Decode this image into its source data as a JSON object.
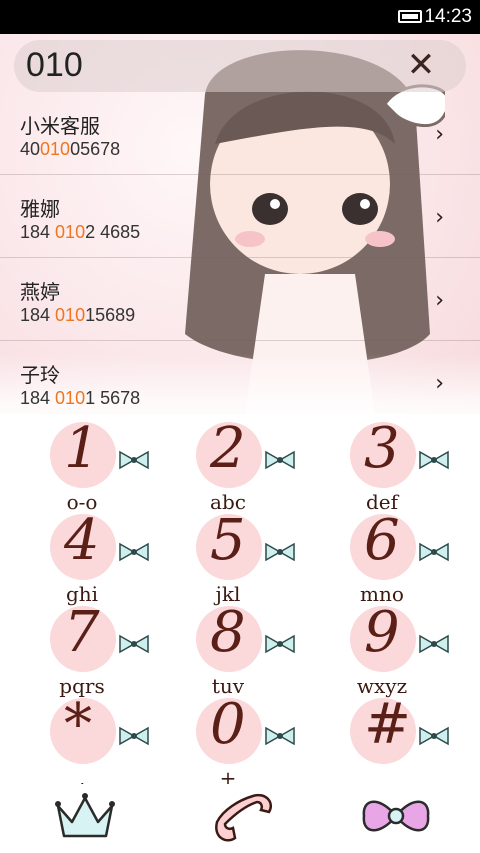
{
  "status_bar": {
    "time": "14:23"
  },
  "search": {
    "query": "010"
  },
  "contacts": [
    {
      "name": "小米客服",
      "num_pre": "40",
      "num_hl": "010",
      "num_post": "05678"
    },
    {
      "name": "雅娜",
      "num_pre": "184 ",
      "num_hl": "010",
      "num_post": "2 4685"
    },
    {
      "name": "燕婷",
      "num_pre": "184 ",
      "num_hl": "010",
      "num_post": "15689"
    },
    {
      "name": "子玲",
      "num_pre": "184 ",
      "num_hl": "010",
      "num_post": "1 5678"
    }
  ],
  "keypad": [
    {
      "digit": "1",
      "letters": "o-o"
    },
    {
      "digit": "2",
      "letters": "abc"
    },
    {
      "digit": "3",
      "letters": "def"
    },
    {
      "digit": "4",
      "letters": "ghi"
    },
    {
      "digit": "5",
      "letters": "jkl"
    },
    {
      "digit": "6",
      "letters": "mno"
    },
    {
      "digit": "7",
      "letters": "pqrs"
    },
    {
      "digit": "8",
      "letters": "tuv"
    },
    {
      "digit": "9",
      "letters": "wxyz"
    },
    {
      "digit": "*",
      "letters": ","
    },
    {
      "digit": "0",
      "letters": "+"
    },
    {
      "digit": "#",
      "letters": ""
    }
  ],
  "bottom_bar": {
    "left_icon": "crown-icon",
    "center_icon": "phone-call-icon",
    "right_icon": "bow-icon"
  },
  "colors": {
    "highlight": "#f0751f",
    "key_circle": "#fbd8da",
    "digit": "#5a1f16"
  }
}
